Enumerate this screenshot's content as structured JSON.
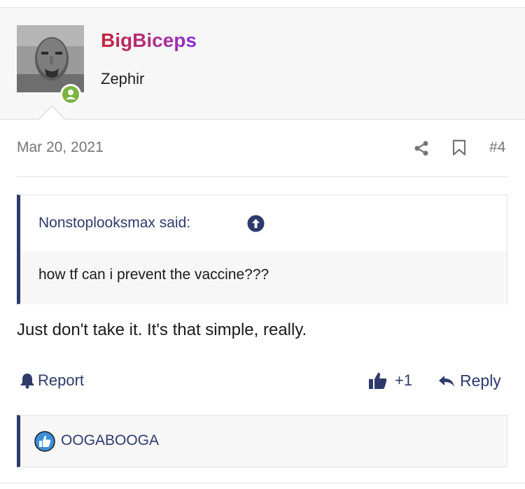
{
  "post": {
    "username": "BigBiceps",
    "user_title": "Zephir",
    "date": "Mar 20, 2021",
    "post_number": "#4",
    "status": "online",
    "quote": {
      "author": "Nonstoplooksmax said:",
      "text": "how tf can i prevent the vaccine???"
    },
    "message": "Just don't take it. It's that simple, really.",
    "actions": {
      "report": "Report",
      "like_count": "+1",
      "reply": "Reply"
    },
    "reactions": {
      "user": "OOGABOOGA",
      "icon": "like-icon"
    }
  },
  "colors": {
    "accent": "#2d3a6b",
    "online": "#7cb342",
    "username_gradient": [
      "#c6243a",
      "#8a2fd8"
    ],
    "like_badge": "#3b8fd9"
  }
}
